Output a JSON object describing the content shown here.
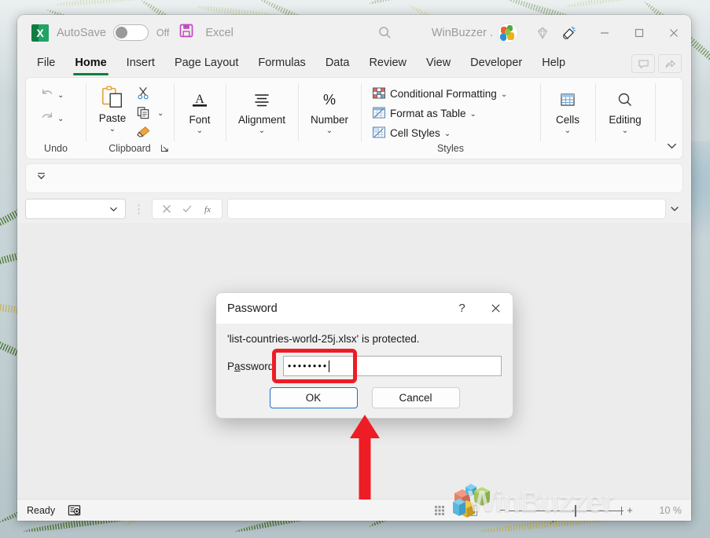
{
  "window": {
    "titlebar": {
      "app_icon": "excel-logo-icon",
      "autosave_label": "AutoSave",
      "autosave_state": "Off",
      "save_icon": "save-icon",
      "document_title": "Excel",
      "search_icon": "search-icon",
      "account_name": "WinBuzzer .",
      "avatar": "user-avatar",
      "diamond_icon": "diamond-icon",
      "megaphone_icon": "megaphone-icon",
      "minimize": "minimize-icon",
      "maximize": "maximize-icon",
      "close": "close-icon"
    },
    "tabs": [
      {
        "label": "File",
        "active": false
      },
      {
        "label": "Home",
        "active": true
      },
      {
        "label": "Insert",
        "active": false
      },
      {
        "label": "Page Layout",
        "active": false
      },
      {
        "label": "Formulas",
        "active": false
      },
      {
        "label": "Data",
        "active": false
      },
      {
        "label": "Review",
        "active": false
      },
      {
        "label": "View",
        "active": false
      },
      {
        "label": "Developer",
        "active": false
      },
      {
        "label": "Help",
        "active": false
      }
    ],
    "tabs_right": [
      {
        "name": "comments-button",
        "icon": "comment-icon"
      },
      {
        "name": "share-button",
        "icon": "share-icon"
      }
    ],
    "ribbon": {
      "groups": [
        {
          "title": "Undo",
          "items": [
            {
              "label": "",
              "icon": "undo-icon"
            },
            {
              "label": "",
              "icon": "redo-icon"
            }
          ]
        },
        {
          "title": "Clipboard",
          "items": [
            {
              "label": "Paste",
              "icon": "paste-icon"
            },
            {
              "label": "",
              "icon": "cut-scissors-icon"
            },
            {
              "label": "",
              "icon": "copy-icon"
            },
            {
              "label": "",
              "icon": "format-painter-icon"
            }
          ],
          "launcher": "clipboard-dialog-launcher"
        },
        {
          "title": "",
          "items": [
            {
              "label": "Font",
              "icon": "font-a-icon"
            }
          ]
        },
        {
          "title": "",
          "items": [
            {
              "label": "Alignment",
              "icon": "alignment-icon"
            }
          ]
        },
        {
          "title": "",
          "items": [
            {
              "label": "Number",
              "icon": "percent-icon"
            }
          ]
        },
        {
          "title": "Styles",
          "items": [
            {
              "label": "Conditional Formatting",
              "icon": "conditional-formatting-icon"
            },
            {
              "label": "Format as Table",
              "icon": "format-as-table-icon"
            },
            {
              "label": "Cell Styles",
              "icon": "cell-styles-icon"
            }
          ]
        },
        {
          "title": "",
          "items": [
            {
              "label": "Cells",
              "icon": "cells-icon"
            }
          ]
        },
        {
          "title": "",
          "items": [
            {
              "label": "Editing",
              "icon": "editing-search-icon"
            }
          ]
        }
      ],
      "collapse_icon": "chevron-down-icon"
    },
    "formula_bar": {
      "name_box_value": "",
      "name_box_placeholder": "",
      "cancel_icon": "cancel-x-icon",
      "enter_icon": "enter-check-icon",
      "function_icon": "insert-function-fx-icon",
      "input_value": "",
      "expand_icon": "expand-formula-bar-icon"
    },
    "status_bar": {
      "status_text": "Ready",
      "accessibility_icon": "accessibility-checker-icon",
      "views": [
        {
          "name": "normal-view-button",
          "icon": "grid-icon"
        },
        {
          "name": "page-layout-view-button",
          "icon": "page-icon"
        }
      ],
      "zoom_out": "−",
      "zoom_in": "+",
      "zoom_level": "10 %"
    }
  },
  "dialog": {
    "title": "Password",
    "help_icon": "help-question-icon",
    "close_icon": "close-icon",
    "message": "'list-countries-world-25j.xlsx' is protected.",
    "password_label_pre": "P",
    "password_label_underlined": "a",
    "password_label_post": "ssword:",
    "password_label_full": "Password:",
    "password_value": "••••••••",
    "buttons": [
      {
        "label": "OK",
        "name": "ok-button",
        "default": true
      },
      {
        "label": "Cancel",
        "name": "cancel-button",
        "default": false
      }
    ]
  },
  "annotations": {
    "highlight_color": "#ee1c25",
    "arrow_color": "#ee1c25",
    "arrow_target": "ok-button"
  },
  "watermark": {
    "text": "WinBuzzer"
  },
  "colors": {
    "excel_green": "#107c41",
    "accent_blue": "#1f6fc4",
    "annotation_red": "#ee1c25"
  }
}
